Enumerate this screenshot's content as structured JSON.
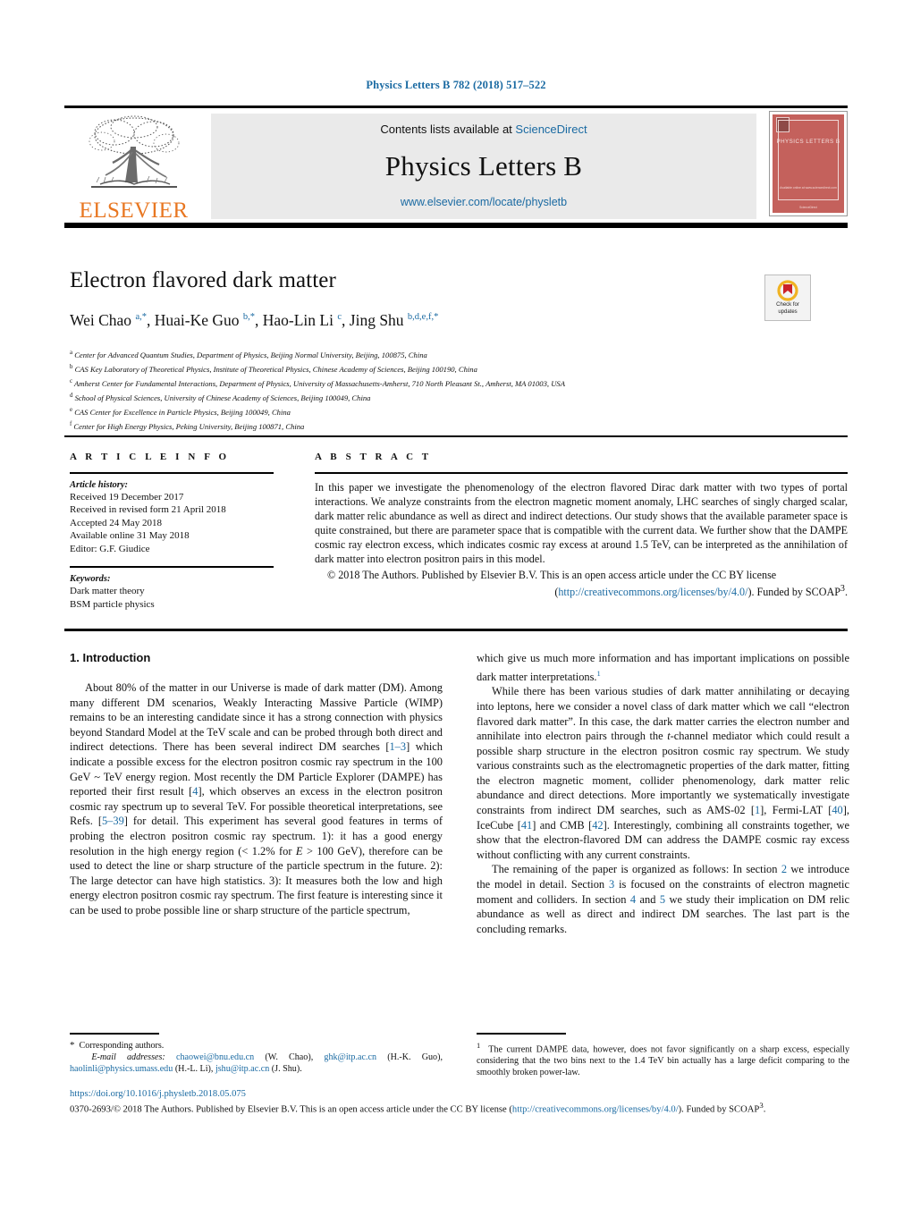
{
  "journal_ref": "Physics Letters B 782 (2018) 517–522",
  "masthead": {
    "contents_prefix": "Contents lists available at ",
    "sciencedirect": "ScienceDirect",
    "journal_title": "Physics Letters B",
    "journal_url": "www.elsevier.com/locate/physletb",
    "publisher_wordmark": "ELSEVIER",
    "publisher_color": "#E87722",
    "cover": {
      "title": "PHYSICS LETTERS B",
      "foot_line1": "Available online at www.sciencedirect.com",
      "foot_line2": "ScienceDirect",
      "bg_color": "#c4615c"
    }
  },
  "article": {
    "title": "Electron flavored dark matter",
    "authors_html": "Wei Chao <sup>a,*</sup>, Huai-Ke Guo <sup>b,*</sup>, Hao-Lin Li <sup>c</sup>, Jing Shu <sup>b,d,e,f,*</sup>",
    "affiliations": [
      {
        "marker": "a",
        "text": "Center for Advanced Quantum Studies, Department of Physics, Beijing Normal University, Beijing, 100875, China"
      },
      {
        "marker": "b",
        "text": "CAS Key Laboratory of Theoretical Physics, Institute of Theoretical Physics, Chinese Academy of Sciences, Beijing 100190, China"
      },
      {
        "marker": "c",
        "text": "Amherst Center for Fundamental Interactions, Department of Physics, University of Massachusetts-Amherst, 710 North Pleasant St., Amherst, MA 01003, USA"
      },
      {
        "marker": "d",
        "text": "School of Physical Sciences, University of Chinese Academy of Sciences, Beijing 100049, China"
      },
      {
        "marker": "e",
        "text": "CAS Center for Excellence in Particle Physics, Beijing 100049, China"
      },
      {
        "marker": "f",
        "text": "Center for High Energy Physics, Peking University, Beijing 100871, China"
      }
    ],
    "crossmark_badge": {
      "line1": "Check for",
      "line2": "updates"
    }
  },
  "article_info": {
    "heading": "A R T I C L E    I N F O",
    "history_label": "Article history:",
    "history": [
      "Received 19 December 2017",
      "Received in revised form 21 April 2018",
      "Accepted 24 May 2018",
      "Available online 31 May 2018",
      "Editor: G.F. Giudice"
    ],
    "keywords_label": "Keywords:",
    "keywords": [
      "Dark matter theory",
      "BSM particle physics"
    ]
  },
  "abstract": {
    "heading": "A B S T R A C T",
    "body": "In this paper we investigate the phenomenology of the electron flavored Dirac dark matter with two types of portal interactions. We analyze constraints from the electron magnetic moment anomaly, LHC searches of singly charged scalar, dark matter relic abundance as well as direct and indirect detections. Our study shows that the available parameter space is quite constrained, but there are parameter space that is compatible with the current data. We further show that the DAMPE cosmic ray electron excess, which indicates cosmic ray excess at around 1.5 TeV, can be interpreted as the annihilation of dark matter into electron positron pairs in this model.",
    "copyright_pre": "© 2018 The Authors. Published by Elsevier B.V. This is an open access article under the CC BY license",
    "license_open": "(",
    "license_url": "http://creativecommons.org/licenses/by/4.0/",
    "license_close": "). Funded by SCOAP",
    "license_sup": "3",
    "license_end": "."
  },
  "body": {
    "section1_title": "1. Introduction",
    "left_paragraphs": [
      "About 80% of the matter in our Universe is made of dark matter (DM). Among many different DM scenarios, Weakly Interacting Massive Particle (WIMP) remains to be an interesting candidate since it has a strong connection with physics beyond Standard Model at the TeV scale and can be probed through both direct and indirect detections. There has been several indirect DM searches [1–3] which indicate a possible excess for the electron positron cosmic ray spectrum in the 100 GeV ~ TeV energy region. Most recently the DM Particle Explorer (DAMPE) has reported their first result [4], which observes an excess in the electron positron cosmic ray spectrum up to several TeV. For possible theoretical interpretations, see Refs. [5–39] for detail. This experiment has several good features in terms of probing the electron positron cosmic ray spectrum. 1): it has a good energy resolution in the high energy region (< 1.2% for E > 100 GeV), therefore can be used to detect the line or sharp structure of the particle spectrum in the future. 2): The large detector can have high statistics. 3): It measures both the low and high energy electron positron cosmic ray spectrum. The first feature is interesting since it can be used to probe possible line or sharp structure of the particle spectrum,"
    ],
    "right_paragraphs": [
      "which give us much more information and has important implications on possible dark matter interpretations.",
      "While there has been various studies of dark matter annihilating or decaying into leptons, here we consider a novel class of dark matter which we call “electron flavored dark matter”. In this case, the dark matter carries the electron number and annihilate into electron pairs through the t-channel mediator which could result a possible sharp structure in the electron positron cosmic ray spectrum. We study various constraints such as the electromagnetic properties of the dark matter, fitting the electron magnetic moment, collider phenomenology, dark matter relic abundance and direct detections. More importantly we systematically investigate constraints from indirect DM searches, such as AMS-02 [1], Fermi-LAT [40], IceCube [41] and CMB [42]. Interestingly, combining all constraints together, we show that the electron-flavored DM can address the DAMPE cosmic ray excess without conflicting with any current constraints.",
      "The remaining of the paper is organized as follows: In section 2 we introduce the model in detail. Section 3 is focused on the constraints of electron magnetic moment and colliders. In section 4 and 5 we study their implication on DM relic abundance as well as direct and indirect DM searches. The last part is the concluding remarks."
    ],
    "footnote_marker": "1"
  },
  "footnotes": {
    "left": {
      "star": "*",
      "corresponding": "Corresponding authors.",
      "email_label": "E-mail addresses:",
      "emails": [
        {
          "address": "chaowei@bnu.edu.cn",
          "who": "(W. Chao)"
        },
        {
          "address": "ghk@itp.ac.cn",
          "who": "(H.-K. Guo)"
        },
        {
          "address": "haolinli@physics.umass.edu",
          "who": "(H.-L. Li)"
        },
        {
          "address": "jshu@itp.ac.cn",
          "who": "(J. Shu)"
        }
      ]
    },
    "right": {
      "marker": "1",
      "text": "The current DAMPE data, however, does not favor significantly on a sharp excess, especially considering that the two bins next to the 1.4 TeV bin actually has a large deficit comparing to the smoothly broken power-law."
    }
  },
  "bottom": {
    "doi": "https://doi.org/10.1016/j.physletb.2018.05.075",
    "issn_copy_pre": "0370-2693/© 2018 The Authors. Published by Elsevier B.V. This is an open access article under the CC BY license (",
    "license_url": "http://creativecommons.org/licenses/by/4.0/",
    "issn_copy_post": "). Funded by ",
    "scoap": "SCOAP",
    "scoap_sup": "3",
    "scoap_end": "."
  },
  "colors": {
    "link": "#1a6aa2",
    "elsevier_orange": "#E87722",
    "band_gray": "#eaeaea"
  }
}
